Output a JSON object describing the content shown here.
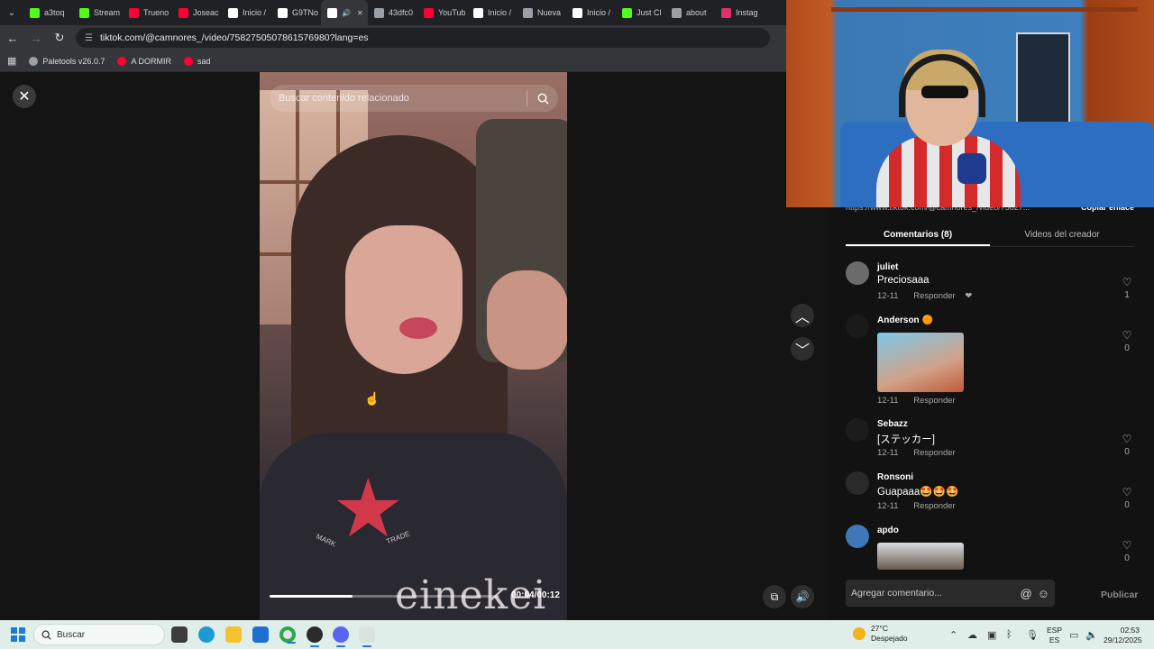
{
  "browser": {
    "tabs": [
      {
        "label": "a3toq",
        "icon": "kick-icon",
        "color": "#53fc18"
      },
      {
        "label": "Stream",
        "icon": "kick-icon",
        "color": "#53fc18"
      },
      {
        "label": "Trueno",
        "icon": "youtube-icon",
        "color": "#ff0033"
      },
      {
        "label": "Joseac",
        "icon": "youtube-icon",
        "color": "#ff0033"
      },
      {
        "label": "Inicio /",
        "icon": "x-icon",
        "color": "#ffffff"
      },
      {
        "label": "G9TNo",
        "icon": "x-icon",
        "color": "#ffffff"
      },
      {
        "label": "",
        "icon": "tiktok-icon",
        "color": "#ffffff",
        "active": true
      },
      {
        "label": "43dfc0",
        "icon": "link-icon",
        "color": "#9aa0a6"
      },
      {
        "label": "YouTub",
        "icon": "youtube-icon",
        "color": "#ff0033"
      },
      {
        "label": "Inicio /",
        "icon": "x-icon",
        "color": "#ffffff"
      },
      {
        "label": "Nueva",
        "icon": "chrome-icon",
        "color": "#9aa0a6"
      },
      {
        "label": "Inicio /",
        "icon": "x-icon",
        "color": "#ffffff"
      },
      {
        "label": "Just Cl",
        "icon": "kick-icon",
        "color": "#53fc18"
      },
      {
        "label": "about",
        "icon": "globe-icon",
        "color": "#9aa0a6"
      },
      {
        "label": "Instag",
        "icon": "instagram-icon",
        "color": "#e1306c"
      }
    ],
    "url": "tiktok.com/@camnores_/video/7582750507861576980?lang=es",
    "bookmarks": [
      {
        "label": "Paletools v26.0.7",
        "color": "#9aa0a6"
      },
      {
        "label": "A DORMIR",
        "color": "#ff0033"
      },
      {
        "label": "sad",
        "color": "#ff0033"
      }
    ]
  },
  "video": {
    "search_placeholder": "Buscar contenido relacionado",
    "time": "00:04/00:12",
    "progress_fraction": 0.36,
    "shirt_words": [
      "MARK",
      "TRADE"
    ],
    "shirt_brand": "einekei"
  },
  "panel": {
    "link_text": "https://www.tiktok.com/@camnores_/video/75827...",
    "copy_link": "Copiar enlace",
    "tabs": [
      "Comentarios (8)",
      "Videos del creador"
    ],
    "comments": [
      {
        "user": "juliet",
        "text": "Preciosaaa",
        "date": "12-11",
        "reply": "Responder",
        "likes": "1"
      },
      {
        "user": "Anderson 🟠",
        "text": "",
        "date": "12-11",
        "reply": "Responder",
        "likes": "0",
        "has_media": true
      },
      {
        "user": "Sebazz",
        "text": "[ステッカー]",
        "date": "12-11",
        "reply": "Responder",
        "likes": "0"
      },
      {
        "user": "Ronsoni",
        "text": "Guapaaa🤩🤩🤩",
        "date": "12-11",
        "reply": "Responder",
        "likes": "0"
      },
      {
        "user": "apdo",
        "text": "",
        "date": "",
        "reply": "",
        "likes": "0",
        "has_media": true
      }
    ],
    "composer_placeholder": "Agregar comentario...",
    "publish": "Publicar"
  },
  "taskbar": {
    "search_placeholder": "Buscar",
    "weather_temp": "27°C",
    "weather_desc": "Despejado",
    "lang_top": "ESP",
    "lang_bottom": "ES",
    "time": "02:53",
    "date": "29/12/2025"
  }
}
